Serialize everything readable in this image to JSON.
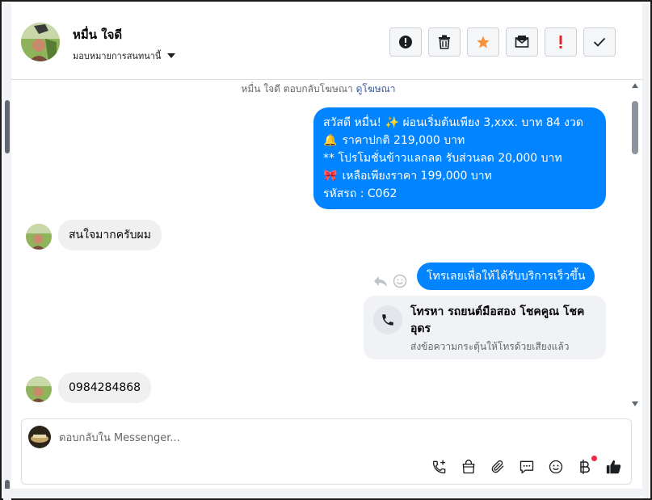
{
  "header": {
    "contact_name": "หมื่น ใจดี",
    "assign_label": "มอบหมายการสนทนานี้",
    "actions": [
      {
        "name": "spam-button",
        "icon": "alert-circle-icon",
        "color": "#1c1e21"
      },
      {
        "name": "delete-button",
        "icon": "trash-icon",
        "color": "#1c1e21"
      },
      {
        "name": "star-button",
        "icon": "star-icon",
        "color": "#f7923b"
      },
      {
        "name": "mark-unread-button",
        "icon": "envelope-icon",
        "color": "#1c1e21"
      },
      {
        "name": "follow-up-button",
        "icon": "exclamation-icon",
        "color": "#e4232b"
      },
      {
        "name": "mark-done-button",
        "icon": "check-icon",
        "color": "#1c1e21"
      }
    ]
  },
  "thread": {
    "reply_note": "หมื่น ใจดี ตอบกลับโฆษณา",
    "reply_note_link": "ดูโฆษณา",
    "msg1_lines": [
      {
        "icon": "",
        "text": "สวัสดี หมื่น! ✨  ผ่อนเริ่มต้นเพียง 3,xxx. บาท 84 งวด"
      },
      {
        "icon": "🔔",
        "text": "ราคาปกติ 219,000 บาท"
      },
      {
        "icon": "",
        "text": "** โปรโมชั่นข้าวแลกลด รับส่วนลด 20,000 บาท"
      },
      {
        "icon": "🎀",
        "text": " เหลือเพียงราคา 199,000 บาท"
      },
      {
        "icon": "",
        "text": " รหัสรถ : C062"
      }
    ],
    "msg2": "สนใจมากครับผม",
    "msg3": "โทรเลยเพื่อให้ได้รับบริการเร็วขึ้น",
    "call_card": {
      "title": "โทรหา รถยนต์มือสอง โชคคูณ โชค อุดร",
      "subtitle": "ส่งข้อความกระตุ้นให้โทรด้วยเสียงแล้ว"
    },
    "msg4": "0984284868"
  },
  "composer": {
    "placeholder": "ตอบกลับใน Messenger...",
    "tools": [
      "phone-plus-icon",
      "shopping-bag-icon",
      "paperclip-icon",
      "chat-icon",
      "emoji-icon",
      "baht-icon",
      "thumbs-up-icon"
    ]
  },
  "colors": {
    "accent": "#0084ff",
    "incoming_bubble": "#f0f0f0",
    "link": "#385898"
  }
}
